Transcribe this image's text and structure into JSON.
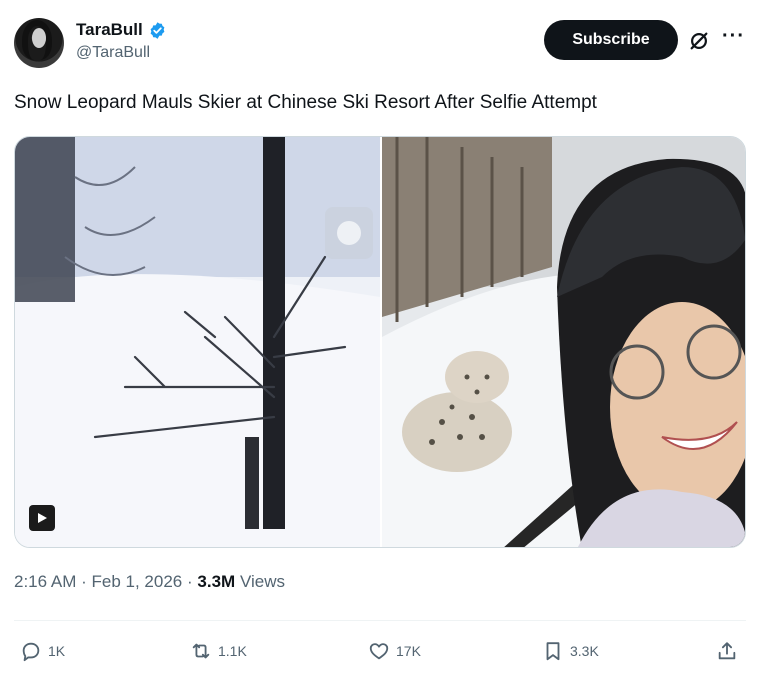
{
  "author": {
    "display_name": "TaraBull",
    "handle": "@TaraBull"
  },
  "header": {
    "subscribe_label": "Subscribe"
  },
  "post": {
    "text": "Snow Leopard Mauls Skier at Chinese Ski Resort After Selfie Attempt",
    "time": "2:16 AM",
    "separator": "·",
    "date": "Feb 1, 2026",
    "views_count": "3.3M",
    "views_label": "Views"
  },
  "actions": {
    "replies": "1K",
    "reposts": "1.1K",
    "likes": "17K",
    "bookmarks": "3.3K"
  },
  "colors": {
    "verified": "#1d9bf0",
    "text_primary": "#0f1419",
    "text_secondary": "#536471",
    "button_bg": "#0f1419"
  },
  "icons": [
    "verified-badge-icon",
    "grok-icon",
    "more-icon",
    "play-icon",
    "reply-icon",
    "repost-icon",
    "like-icon",
    "bookmark-icon",
    "share-icon"
  ]
}
